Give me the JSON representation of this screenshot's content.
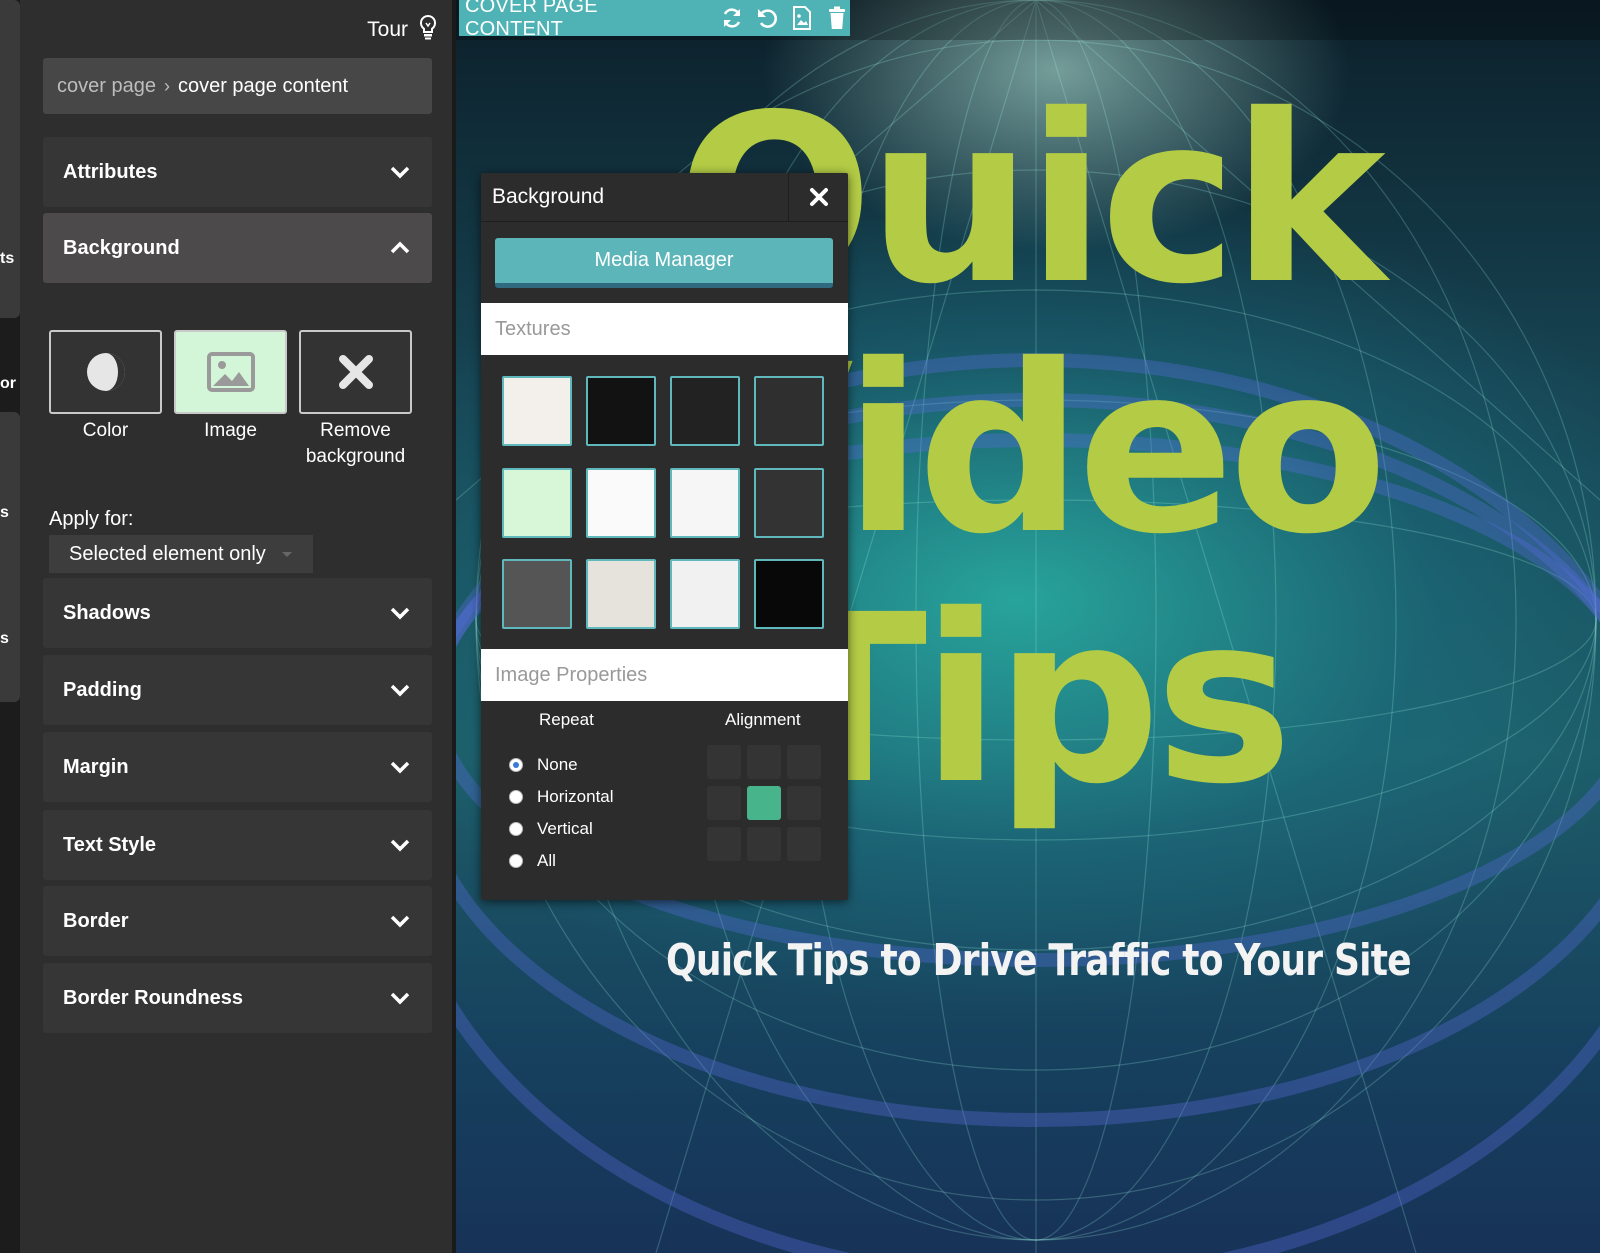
{
  "rail": {
    "labels": [
      "ts",
      "or",
      "s",
      "s"
    ]
  },
  "header": {
    "tour_label": "Tour"
  },
  "breadcrumb": {
    "parent": "cover page",
    "current": "cover page content"
  },
  "sections": {
    "attributes": "Attributes",
    "background": "Background",
    "shadows": "Shadows",
    "padding": "Padding",
    "margin": "Margin",
    "text_style": "Text Style",
    "border": "Border",
    "border_roundness": "Border Roundness"
  },
  "background_options": {
    "color": "Color",
    "image": "Image",
    "remove": "Remove background",
    "selected": "Image"
  },
  "apply_for": {
    "label": "Apply for:",
    "value": "Selected element only"
  },
  "toolbar": {
    "title": "COVER PAGE CONTENT",
    "icons": [
      "refresh-icon",
      "undo-icon",
      "image-file-icon",
      "trash-icon"
    ]
  },
  "canvas": {
    "hero_lines": [
      "Quick",
      "Video",
      "Tips"
    ],
    "subtitle": "Quick Tips to Drive Traffic to Your Site",
    "hero_color": "#b3cb45"
  },
  "popup": {
    "title": "Background",
    "media_manager": "Media Manager",
    "textures_label": "Textures",
    "textures": [
      {
        "color": "#f3efea"
      },
      {
        "color": "#121212"
      },
      {
        "color": "#222222"
      },
      {
        "color": "#2f2f2f"
      },
      {
        "color": "#d8f7d9"
      },
      {
        "color": "#fafafa"
      },
      {
        "color": "#f6f6f6"
      },
      {
        "color": "#333333"
      },
      {
        "color": "#555555"
      },
      {
        "color": "#e6e3dd"
      },
      {
        "color": "#f1f1f1"
      },
      {
        "color": "#080808"
      }
    ],
    "image_properties_label": "Image Properties",
    "repeat_label": "Repeat",
    "alignment_label": "Alignment",
    "repeat_options": [
      "None",
      "Horizontal",
      "Vertical",
      "All"
    ],
    "repeat_selected": "None",
    "alignment_selected": "center"
  },
  "colors": {
    "accent": "#4fb3b6",
    "panel": "#2e2e2e",
    "alignment_active": "#47b48b"
  }
}
